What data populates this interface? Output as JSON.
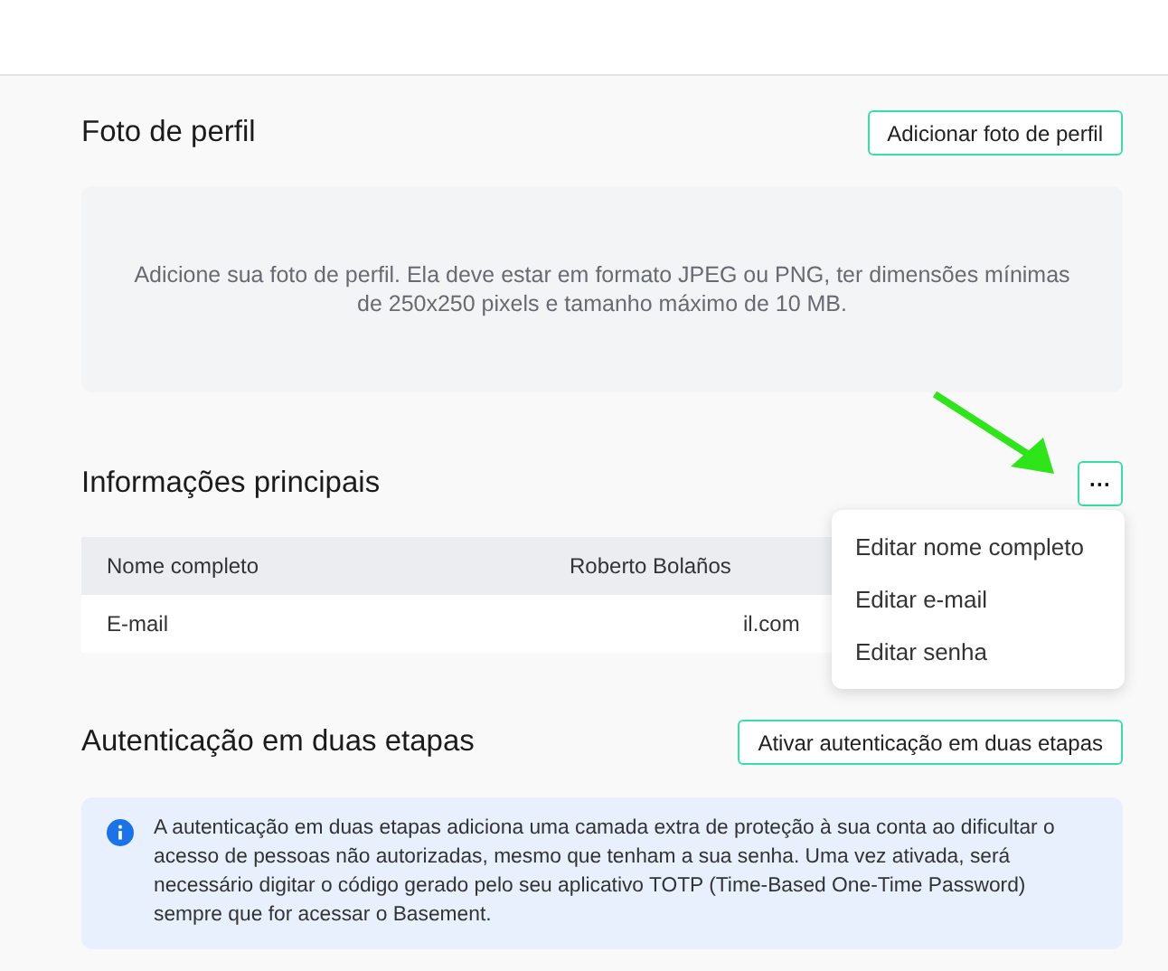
{
  "photo_section": {
    "title": "Foto de perfil",
    "button": "Adicionar foto de perfil",
    "hint": "Adicione sua foto de perfil. Ela deve estar em formato JPEG ou PNG, ter dimensões mínimas de 250x250 pixels e tamanho máximo de 10 MB."
  },
  "main_info": {
    "title": "Informações principais",
    "menu_button": "···",
    "rows": [
      {
        "label": "Nome completo",
        "value": "Roberto Bolaños"
      },
      {
        "label": "E-mail",
        "value": "il.com",
        "kind": "redacted"
      }
    ],
    "menu": [
      {
        "label": "Editar nome completo"
      },
      {
        "label": "Editar e-mail"
      },
      {
        "label": "Editar senha"
      }
    ]
  },
  "two_factor": {
    "title": "Autenticação em duas etapas",
    "button": "Ativar autenticação em duas etapas",
    "info": "A autenticação em duas etapas adiciona uma camada extra de proteção à sua conta ao dificultar o acesso de pessoas não autorizadas, mesmo que tenham a sua senha. Uma vez ativada, será necessário digitar o código gerado pelo seu aplicativo TOTP (Time-Based One-Time Password) sempre que for acessar o Basement."
  }
}
